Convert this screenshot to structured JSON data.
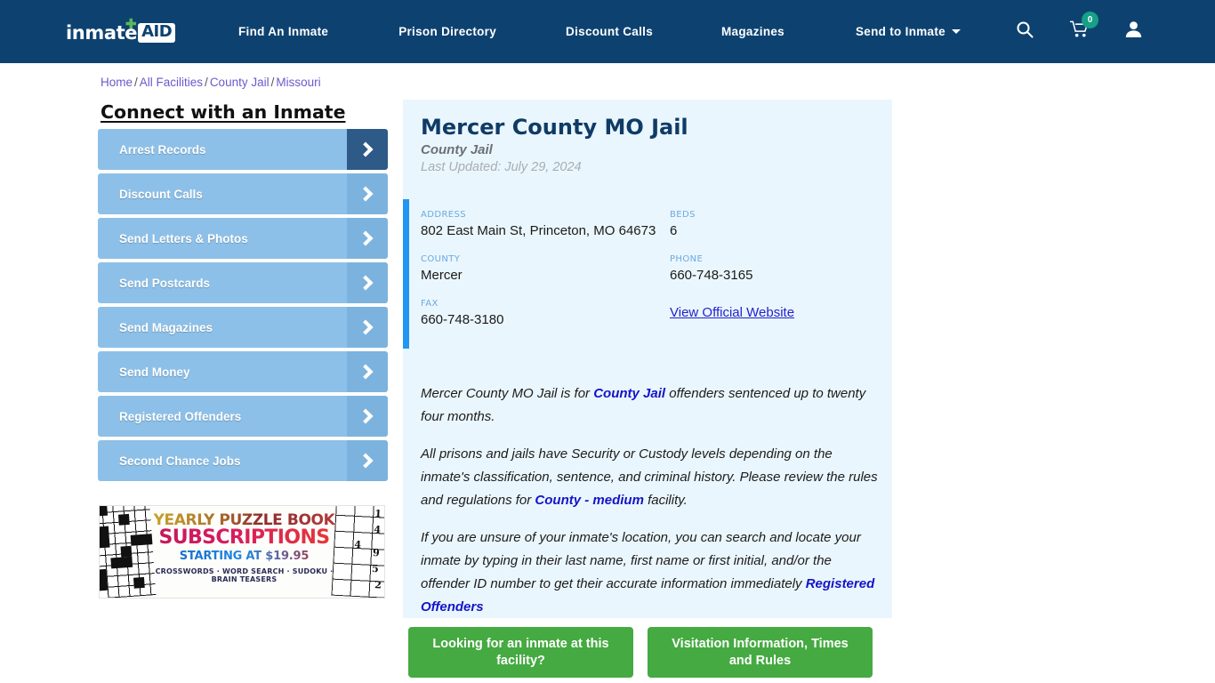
{
  "header": {
    "logo": {
      "word": "inmate",
      "badge": "AID",
      "plus_icon": "plus-icon"
    },
    "nav": [
      {
        "label": "Find An Inmate"
      },
      {
        "label": "Prison Directory"
      },
      {
        "label": "Discount Calls"
      },
      {
        "label": "Magazines"
      },
      {
        "label": "Send to Inmate",
        "has_dropdown": true
      }
    ],
    "icons": {
      "search": "search-icon",
      "cart": "shopping-cart-icon",
      "cart_count": "0",
      "account": "user-account-icon"
    },
    "background_color": "#0d4270"
  },
  "breadcrumb": {
    "items": [
      "Home",
      "All Facilities",
      "County Jail",
      "Missouri"
    ],
    "separator": "/",
    "link_color": "#6a5acd"
  },
  "sidebar": {
    "title": "Connect with an Inmate",
    "items": [
      {
        "label": "Arrest Records",
        "active": true
      },
      {
        "label": "Discount Calls",
        "active": false
      },
      {
        "label": "Send Letters & Photos",
        "active": false
      },
      {
        "label": "Send Postcards",
        "active": false
      },
      {
        "label": "Send Magazines",
        "active": false
      },
      {
        "label": "Send Money",
        "active": false
      },
      {
        "label": "Registered Offenders",
        "active": false
      },
      {
        "label": "Second Chance Jobs",
        "active": false
      }
    ],
    "button_color": "#8dc0e8",
    "active_arrow_color": "#2d5a87"
  },
  "ad": {
    "line1": "YEARLY PUZZLE BOOK",
    "line2": "SUBSCRIPTIONS",
    "line3": "STARTING AT $19.95",
    "line4": "CROSSWORDS · WORD SEARCH · SUDOKU · BRAIN TEASERS",
    "sudoku_numbers": [
      "1",
      "4",
      "4",
      "9",
      "5",
      "2"
    ]
  },
  "facility": {
    "name": "Mercer County MO Jail",
    "type": "County Jail",
    "last_updated": "Last Updated: July 29, 2024",
    "info": [
      {
        "label": "ADDRESS",
        "value": "802 East Main St, Princeton, MO 64673"
      },
      {
        "label": "BEDS",
        "value": "6"
      },
      {
        "label": "COUNTY",
        "value": "Mercer"
      },
      {
        "label": "PHONE",
        "value": "660-748-3165"
      },
      {
        "label": "FAX",
        "value": "660-748-3180"
      }
    ],
    "website_link": "View Official Website",
    "accent_color": "#2196f3",
    "panel_color": "#eaf6fd"
  },
  "description": {
    "p1_a": "Mercer County MO Jail is for ",
    "p1_hi": "County Jail",
    "p1_b": " offenders sentenced up to twenty four months.",
    "p2_a": "All prisons and jails have Security or Custody levels depending on the inmate's classification, sentence, and criminal history. Please review the rules and regulations for ",
    "p2_hi": "County - medium",
    "p2_b": " facility.",
    "p3_a": "If you are unsure of your inmate's location, you can search and locate your inmate by typing in their last name, first name or first initial, and/or the offender ID number to get their accurate information immediately ",
    "p3_link": "Registered Offenders"
  },
  "cta": {
    "buttons": [
      {
        "label": "Looking for an inmate at this facility?"
      },
      {
        "label": "Visitation Information, Times and Rules"
      }
    ],
    "color": "#45aa41"
  }
}
